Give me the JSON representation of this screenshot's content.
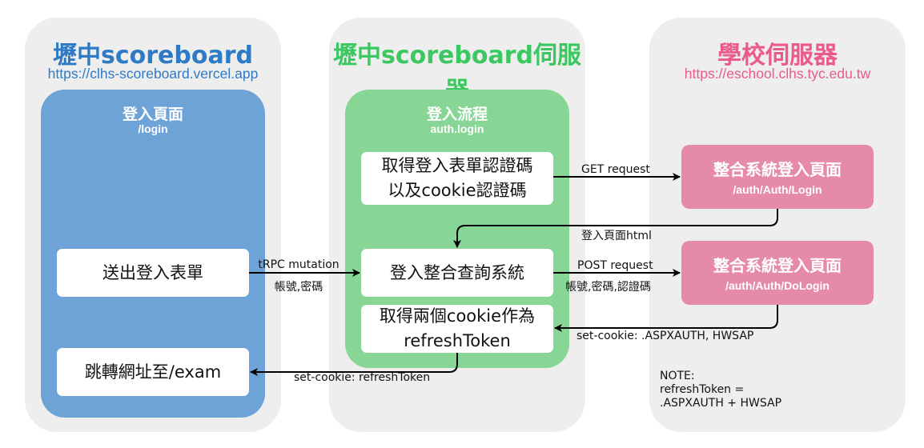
{
  "columns": {
    "client": {
      "title": "壢中scoreboard",
      "url": "https://clhs-scoreboard.vercel.app",
      "title_color": "#2f7ac4",
      "url_color": "#2f7ac4"
    },
    "server": {
      "title": "壢中scoreboard伺服器",
      "title_color": "#3cc860"
    },
    "school": {
      "title": "學校伺服器",
      "url": "https://eschool.clhs.tyc.edu.tw",
      "title_color": "#ea5a8a",
      "url_color": "#ea5a8a"
    }
  },
  "panels": {
    "login_page": {
      "title": "登入頁面",
      "subtitle": "/login",
      "color": "#6ea3d8"
    },
    "login_flow": {
      "title": "登入流程",
      "subtitle": "auth.login",
      "color": "#88d695"
    }
  },
  "boxes": {
    "send_form": "送出登入表單",
    "redirect": "跳轉網址至/exam",
    "get_codes": "取得登入表單認證碼\n以及cookie認證碼",
    "login_query": "登入整合查詢系統",
    "get_cookies": "取得兩個cookie作為\nrefreshToken"
  },
  "school_boxes": {
    "login": {
      "title": "整合系統登入頁面",
      "subtitle": "/auth/Auth/Login",
      "color": "#e68aaa"
    },
    "dologin": {
      "title": "整合系統登入頁面",
      "subtitle": "/auth/Auth/DoLogin",
      "color": "#e68aaa"
    }
  },
  "edge_labels": {
    "trpc_1": "tRPC mutation",
    "trpc_2": "帳號,密碼",
    "get_request": "GET request",
    "login_html": "登入頁面html",
    "post_request": "POST request",
    "post_params": "帳號,密碼,認證碼",
    "set_cookie_school": "set-cookie: .ASPXAUTH, HWSAP",
    "set_cookie_client": "set-cookie: refreshToken"
  },
  "note": {
    "line1": "NOTE:",
    "line2": "refreshToken =",
    "line3": ".ASPXAUTH + HWSAP"
  },
  "colors": {
    "column_bg": "#eeeeee",
    "arrow": "#000000"
  }
}
